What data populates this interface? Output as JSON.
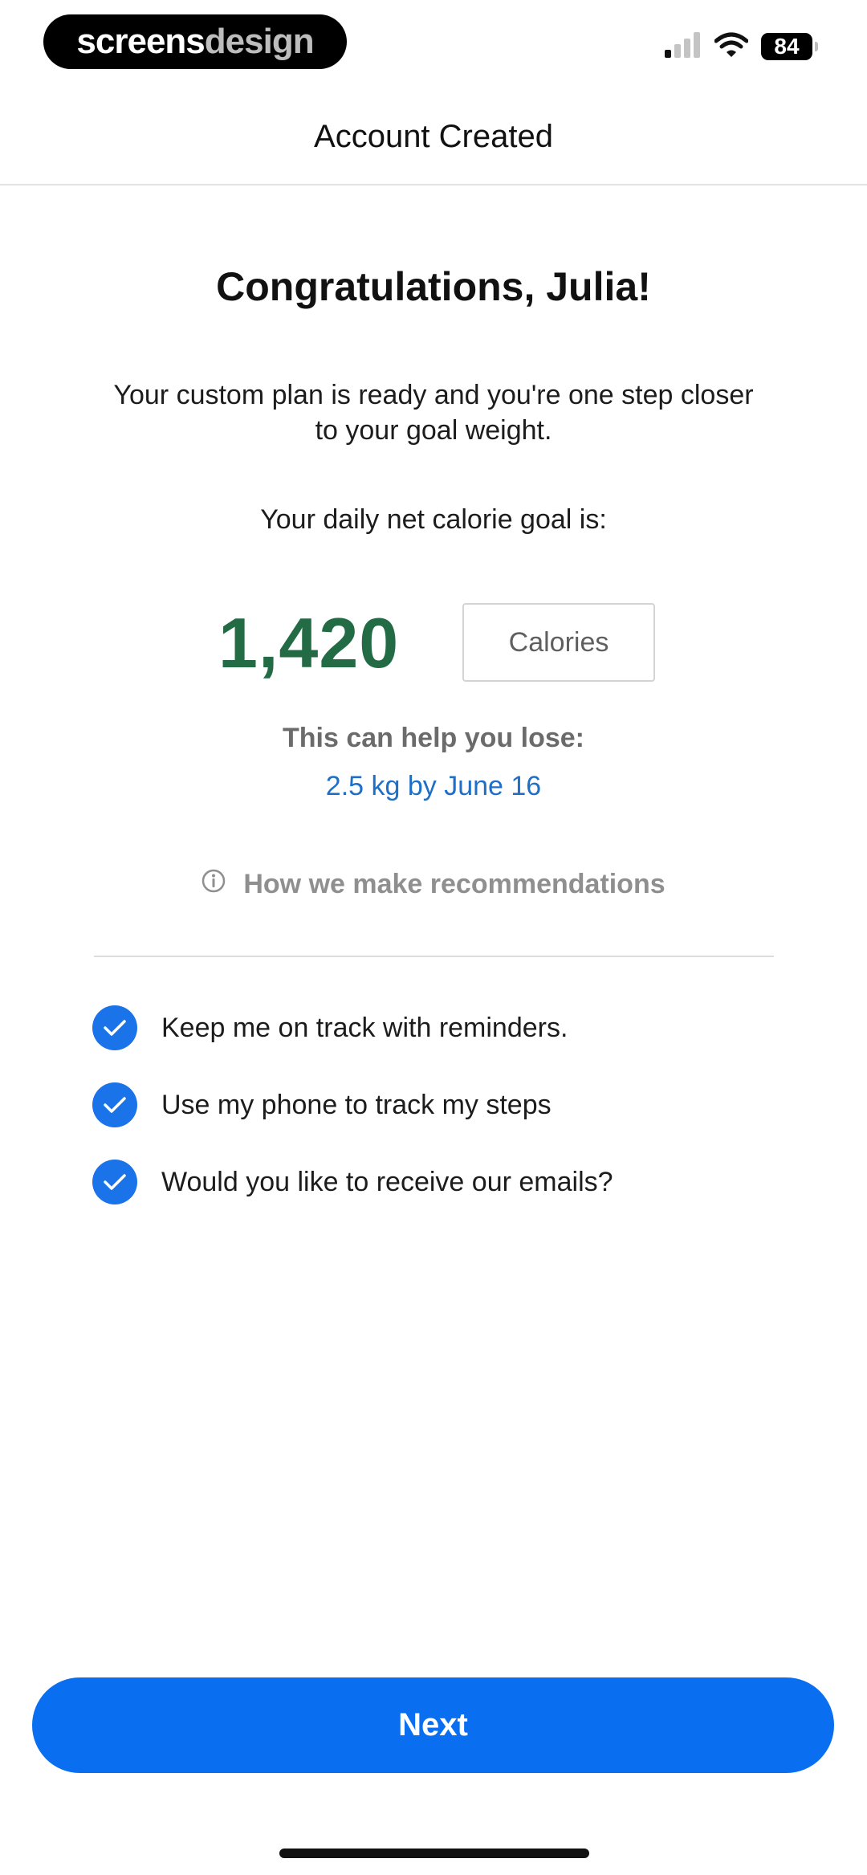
{
  "status_bar": {
    "brand_part1": "screens",
    "brand_part2": "design",
    "battery": "84",
    "icons": [
      "signal-icon",
      "wifi-icon",
      "battery-icon"
    ]
  },
  "nav": {
    "title": "Account Created"
  },
  "main": {
    "heading": "Congratulations, Julia!",
    "subtitle": "Your custom plan is ready and you're one step closer to your goal weight.",
    "goal_label": "Your daily net calorie goal is:",
    "calorie_value": "1,420",
    "calorie_unit": "Calories",
    "lose_label": "This can help you lose:",
    "lose_value": "2.5 kg by June 16",
    "recommendations_link": "How we make recommendations"
  },
  "options": [
    {
      "label": "Keep me on track with reminders.",
      "checked": true
    },
    {
      "label": "Use my phone to track my steps",
      "checked": true
    },
    {
      "label": "Would you like to receive our emails?",
      "checked": true
    }
  ],
  "footer": {
    "next_label": "Next"
  },
  "colors": {
    "accent": "#0a6ef0",
    "checkbox": "#1a73e8",
    "calorie_green": "#236b45",
    "link_blue": "#1f6fc7"
  }
}
